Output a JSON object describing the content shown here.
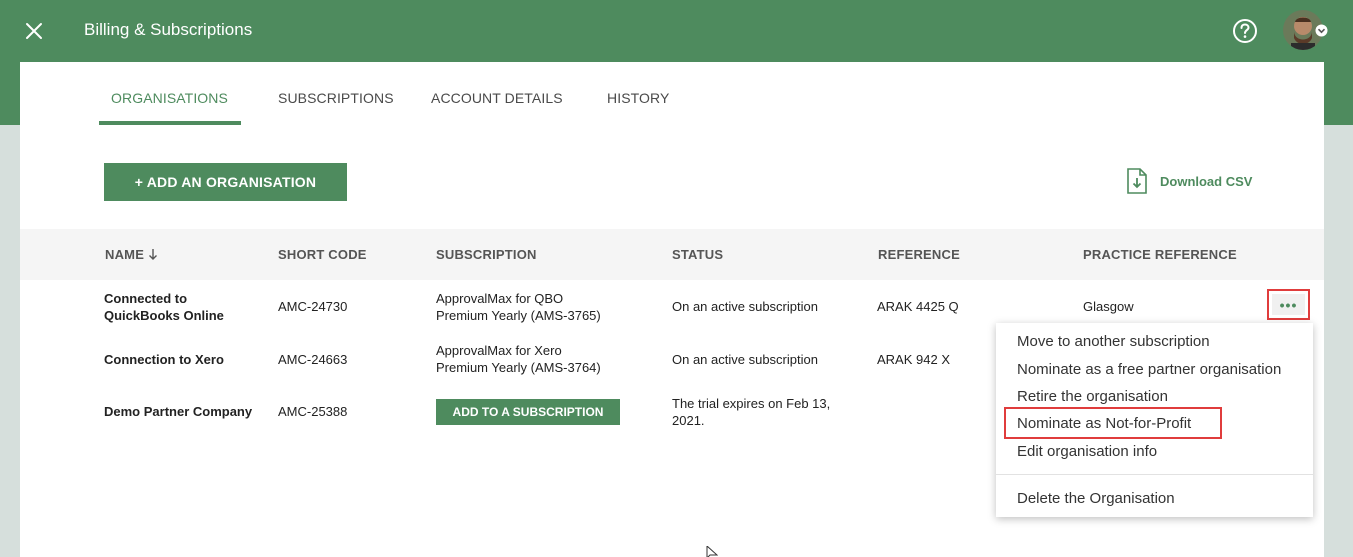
{
  "header": {
    "title": "Billing & Subscriptions",
    "close_icon": "close-icon",
    "help_icon": "help-icon",
    "avatar_icon": "user-avatar"
  },
  "tabs": [
    {
      "label": "ORGANISATIONS",
      "active": true
    },
    {
      "label": "SUBSCRIPTIONS",
      "active": false
    },
    {
      "label": "ACCOUNT DETAILS",
      "active": false
    },
    {
      "label": "HISTORY",
      "active": false
    }
  ],
  "toolbar": {
    "add_org_label": "+ ADD AN ORGANISATION",
    "download_csv_label": "Download CSV"
  },
  "table": {
    "columns": [
      "NAME",
      "SHORT CODE",
      "SUBSCRIPTION",
      "STATUS",
      "REFERENCE",
      "PRACTICE REFERENCE"
    ],
    "rows": [
      {
        "name": [
          "Connected to",
          "QuickBooks Online"
        ],
        "short_code": "AMC-24730",
        "subscription": [
          "ApprovalMax for QBO",
          "Premium Yearly (AMS-3765)"
        ],
        "status": [
          "On an active subscription"
        ],
        "reference": "ARAK 4425 Q",
        "practice_reference": "Glasgow"
      },
      {
        "name": [
          "Connection to Xero"
        ],
        "short_code": "AMC-24663",
        "subscription": [
          "ApprovalMax for Xero",
          "Premium Yearly (AMS-3764)"
        ],
        "status": [
          "On an active subscription"
        ],
        "reference": "ARAK 942 X",
        "practice_reference": ""
      },
      {
        "name": [
          "Demo Partner Company"
        ],
        "short_code": "AMC-25388",
        "subscription_button": "ADD TO A SUBSCRIPTION",
        "status": [
          "The trial expires on Feb 13,",
          "2021."
        ],
        "reference": "",
        "practice_reference": ""
      }
    ]
  },
  "row_menu": {
    "items": [
      "Move to another subscription",
      "Nominate as a free partner organisation",
      "Retire the organisation",
      "Nominate as Not-for-Profit",
      "Edit organisation info",
      "Delete the Organisation"
    ],
    "highlighted_item": "Nominate as Not-for-Profit"
  },
  "colors": {
    "brand_green": "#4e8b5e",
    "highlight_red": "#e03c3c"
  }
}
